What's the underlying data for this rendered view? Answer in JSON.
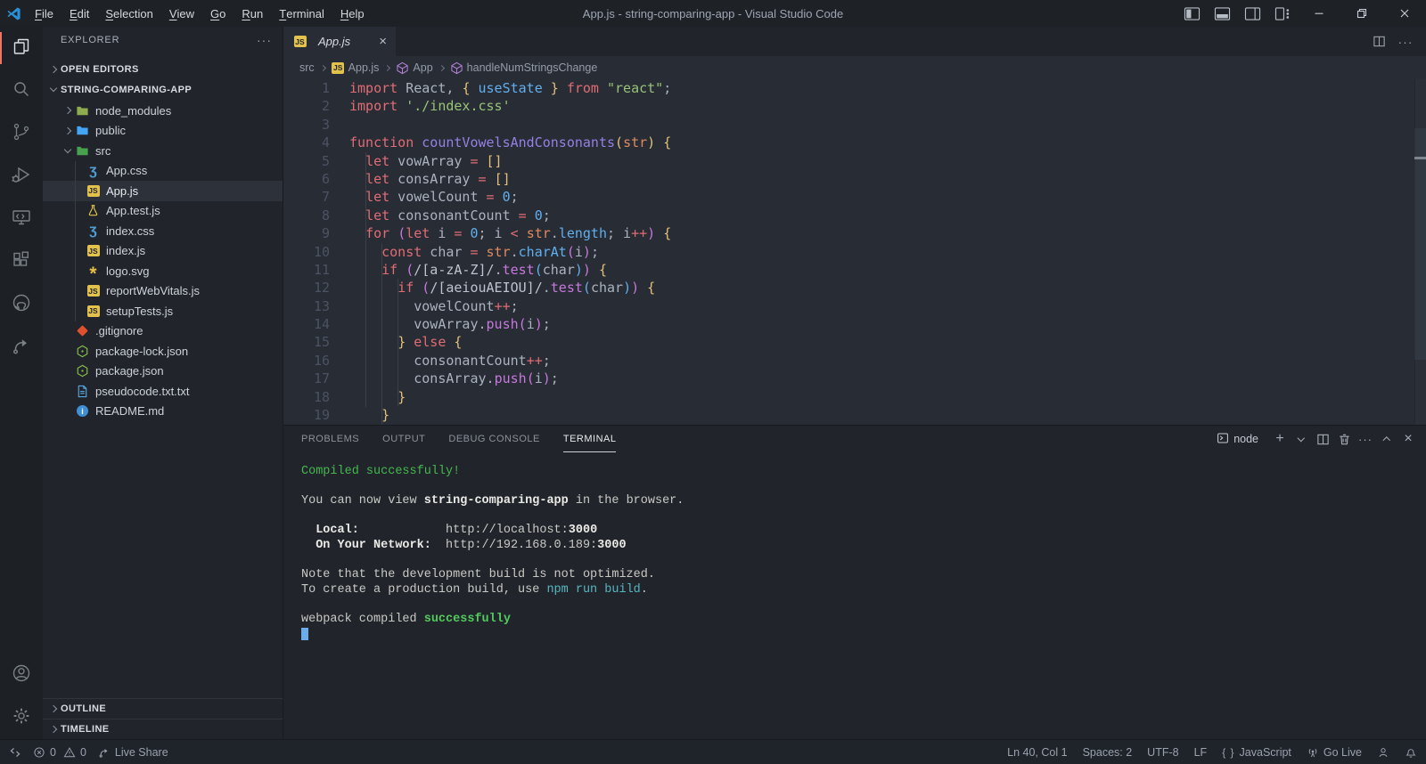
{
  "window": {
    "title": "App.js - string-comparing-app - Visual Studio Code"
  },
  "menus": [
    "File",
    "Edit",
    "Selection",
    "View",
    "Go",
    "Run",
    "Terminal",
    "Help"
  ],
  "titlebar_actions": [
    {
      "name": "toggle-sidebar",
      "icon": "panel-left"
    },
    {
      "name": "toggle-panel",
      "icon": "panel-bottom"
    },
    {
      "name": "toggle-secondary-sidebar",
      "icon": "panel-right"
    },
    {
      "name": "customize-layout",
      "icon": "layout"
    }
  ],
  "window_controls": [
    {
      "name": "minimize",
      "icon": "minimize"
    },
    {
      "name": "restore",
      "icon": "restore"
    },
    {
      "name": "close-window",
      "icon": "close-win"
    }
  ],
  "activity_bar": {
    "top": [
      {
        "name": "explorer",
        "icon": "files",
        "active": true
      },
      {
        "name": "search",
        "icon": "search"
      },
      {
        "name": "source-control",
        "icon": "source-control"
      },
      {
        "name": "run-and-debug",
        "icon": "debug"
      },
      {
        "name": "remote-explorer",
        "icon": "remote"
      },
      {
        "name": "extensions",
        "icon": "extensions"
      },
      {
        "name": "github",
        "icon": "github"
      },
      {
        "name": "live-share",
        "icon": "share"
      }
    ],
    "bottom": [
      {
        "name": "accounts",
        "icon": "account"
      },
      {
        "name": "settings",
        "icon": "gear"
      }
    ]
  },
  "sidebar": {
    "title": "EXPLORER",
    "more_glyph": "···",
    "sections": {
      "open_editors": "OPEN EDITORS",
      "project": "STRING-COMPARING-APP",
      "outline": "OUTLINE",
      "timeline": "TIMELINE"
    },
    "tree": [
      {
        "label": "node_modules",
        "icon": "folder-green",
        "depth": 1,
        "chevron": "right"
      },
      {
        "label": "public",
        "icon": "folder-blue",
        "depth": 1,
        "chevron": "right"
      },
      {
        "label": "src",
        "icon": "folder-src",
        "depth": 1,
        "chevron": "down"
      },
      {
        "label": "App.css",
        "icon": "css",
        "depth": 2
      },
      {
        "label": "App.js",
        "icon": "js",
        "depth": 2,
        "selected": true
      },
      {
        "label": "App.test.js",
        "icon": "test",
        "depth": 2
      },
      {
        "label": "index.css",
        "icon": "css",
        "depth": 2
      },
      {
        "label": "index.js",
        "icon": "js",
        "depth": 2
      },
      {
        "label": "logo.svg",
        "icon": "svg",
        "depth": 2
      },
      {
        "label": "reportWebVitals.js",
        "icon": "js",
        "depth": 2
      },
      {
        "label": "setupTests.js",
        "icon": "js",
        "depth": 2
      },
      {
        "label": ".gitignore",
        "icon": "git",
        "depth": 1
      },
      {
        "label": "package-lock.json",
        "icon": "npm",
        "depth": 1
      },
      {
        "label": "package.json",
        "icon": "npm",
        "depth": 1
      },
      {
        "label": "pseudocode.txt.txt",
        "icon": "txt",
        "depth": 1
      },
      {
        "label": "README.md",
        "icon": "info",
        "depth": 1
      }
    ]
  },
  "editor": {
    "tab": {
      "label": "App.js",
      "icon": "js",
      "close_glyph": "×"
    },
    "tab_actions": [
      {
        "name": "split-editor",
        "icon": "split"
      },
      {
        "name": "more-actions",
        "icon": "more"
      }
    ],
    "breadcrumbs": [
      {
        "label": "src"
      },
      {
        "label": "App.js",
        "icon": "js"
      },
      {
        "label": "App",
        "icon": "symbol-class"
      },
      {
        "label": "handleNumStringsChange",
        "icon": "symbol-class"
      }
    ],
    "code": [
      {
        "n": 1,
        "t": [
          [
            "kw",
            "import"
          ],
          [
            "tx",
            " React, "
          ],
          [
            "b1",
            "{"
          ],
          [
            "bl",
            " useState "
          ],
          [
            "b1",
            "}"
          ],
          [
            "kw",
            " from "
          ],
          [
            "st",
            "\"react\""
          ],
          [
            "tx",
            ";"
          ]
        ]
      },
      {
        "n": 2,
        "t": [
          [
            "kw",
            "import"
          ],
          [
            "st",
            " './index.css'"
          ]
        ]
      },
      {
        "n": 3,
        "t": []
      },
      {
        "n": 4,
        "t": [
          [
            "kw",
            "function"
          ],
          [
            "fn",
            " countVowelsAndConsonants"
          ],
          [
            "b1",
            "("
          ],
          [
            "pr",
            "str"
          ],
          [
            "b1",
            ")"
          ],
          [
            "tx",
            " "
          ],
          [
            "b1",
            "{"
          ]
        ]
      },
      {
        "n": 5,
        "t": [
          [
            "tx",
            "  "
          ],
          [
            "kw",
            "let"
          ],
          [
            "tx",
            " vowArray "
          ],
          [
            "op",
            "="
          ],
          [
            "tx",
            " "
          ],
          [
            "b1",
            "[]"
          ]
        ]
      },
      {
        "n": 6,
        "t": [
          [
            "tx",
            "  "
          ],
          [
            "kw",
            "let"
          ],
          [
            "tx",
            " consArray "
          ],
          [
            "op",
            "="
          ],
          [
            "tx",
            " "
          ],
          [
            "b1",
            "[]"
          ]
        ]
      },
      {
        "n": 7,
        "t": [
          [
            "tx",
            "  "
          ],
          [
            "kw",
            "let"
          ],
          [
            "tx",
            " vowelCount "
          ],
          [
            "op",
            "="
          ],
          [
            "tx",
            " "
          ],
          [
            "bl",
            "0"
          ],
          [
            "tx",
            ";"
          ]
        ]
      },
      {
        "n": 8,
        "t": [
          [
            "tx",
            "  "
          ],
          [
            "kw",
            "let"
          ],
          [
            "tx",
            " consonantCount "
          ],
          [
            "op",
            "="
          ],
          [
            "tx",
            " "
          ],
          [
            "bl",
            "0"
          ],
          [
            "tx",
            ";"
          ]
        ]
      },
      {
        "n": 9,
        "t": [
          [
            "tx",
            "  "
          ],
          [
            "kw",
            "for"
          ],
          [
            "tx",
            " "
          ],
          [
            "b2",
            "("
          ],
          [
            "kw",
            "let"
          ],
          [
            "tx",
            " i "
          ],
          [
            "op",
            "="
          ],
          [
            "tx",
            " "
          ],
          [
            "bl",
            "0"
          ],
          [
            "tx",
            "; i "
          ],
          [
            "op",
            "<"
          ],
          [
            "tx",
            " "
          ],
          [
            "pr",
            "str"
          ],
          [
            "tx",
            "."
          ],
          [
            "bl",
            "length"
          ],
          [
            "tx",
            "; i"
          ],
          [
            "op",
            "++"
          ],
          [
            "b2",
            ")"
          ],
          [
            "tx",
            " "
          ],
          [
            "b1",
            "{"
          ]
        ]
      },
      {
        "n": 10,
        "t": [
          [
            "tx",
            "    "
          ],
          [
            "kw",
            "const"
          ],
          [
            "tx",
            " char "
          ],
          [
            "op",
            "="
          ],
          [
            "tx",
            " "
          ],
          [
            "pr",
            "str"
          ],
          [
            "tx",
            "."
          ],
          [
            "bl",
            "charAt"
          ],
          [
            "b2",
            "("
          ],
          [
            "tx",
            "i"
          ],
          [
            "b2",
            ")"
          ],
          [
            "tx",
            ";"
          ]
        ]
      },
      {
        "n": 11,
        "t": [
          [
            "tx",
            "    "
          ],
          [
            "kw",
            "if"
          ],
          [
            "tx",
            " "
          ],
          [
            "b2",
            "("
          ],
          [
            "rx",
            "/[a-zA-Z]/"
          ],
          [
            "tx",
            "."
          ],
          [
            "mt",
            "test"
          ],
          [
            "b3",
            "("
          ],
          [
            "tx",
            "char"
          ],
          [
            "b3",
            ")"
          ],
          [
            "b2",
            ")"
          ],
          [
            "tx",
            " "
          ],
          [
            "b1",
            "{"
          ]
        ]
      },
      {
        "n": 12,
        "t": [
          [
            "tx",
            "      "
          ],
          [
            "kw",
            "if"
          ],
          [
            "tx",
            " "
          ],
          [
            "b2",
            "("
          ],
          [
            "rx",
            "/[aeiouAEIOU]/"
          ],
          [
            "tx",
            "."
          ],
          [
            "mt",
            "test"
          ],
          [
            "b3",
            "("
          ],
          [
            "tx",
            "char"
          ],
          [
            "b3",
            ")"
          ],
          [
            "b2",
            ")"
          ],
          [
            "tx",
            " "
          ],
          [
            "b1",
            "{"
          ]
        ]
      },
      {
        "n": 13,
        "t": [
          [
            "tx",
            "        vowelCount"
          ],
          [
            "op",
            "++"
          ],
          [
            "tx",
            ";"
          ]
        ]
      },
      {
        "n": 14,
        "t": [
          [
            "tx",
            "        vowArray"
          ],
          [
            "tx",
            "."
          ],
          [
            "mt",
            "push"
          ],
          [
            "b2",
            "("
          ],
          [
            "tx",
            "i"
          ],
          [
            "b2",
            ")"
          ],
          [
            "tx",
            ";"
          ]
        ]
      },
      {
        "n": 15,
        "t": [
          [
            "tx",
            "      "
          ],
          [
            "b1",
            "}"
          ],
          [
            "kw",
            " else "
          ],
          [
            "b1",
            "{"
          ]
        ]
      },
      {
        "n": 16,
        "t": [
          [
            "tx",
            "        consonantCount"
          ],
          [
            "op",
            "++"
          ],
          [
            "tx",
            ";"
          ]
        ]
      },
      {
        "n": 17,
        "t": [
          [
            "tx",
            "        consArray"
          ],
          [
            "tx",
            "."
          ],
          [
            "mt",
            "push"
          ],
          [
            "b2",
            "("
          ],
          [
            "tx",
            "i"
          ],
          [
            "b2",
            ")"
          ],
          [
            "tx",
            ";"
          ]
        ]
      },
      {
        "n": 18,
        "t": [
          [
            "tx",
            "      "
          ],
          [
            "b1",
            "}"
          ]
        ]
      },
      {
        "n": 19,
        "t": [
          [
            "tx",
            "    "
          ],
          [
            "b1",
            "}"
          ]
        ]
      }
    ]
  },
  "panel": {
    "tabs": [
      {
        "label": "PROBLEMS"
      },
      {
        "label": "OUTPUT"
      },
      {
        "label": "DEBUG CONSOLE"
      },
      {
        "label": "TERMINAL",
        "active": true
      }
    ],
    "shell": {
      "icon": "terminal",
      "label": "node"
    },
    "actions": [
      {
        "name": "new-terminal",
        "icon": "plus"
      },
      {
        "name": "launch-profile",
        "icon": "chev-down"
      },
      {
        "name": "split-terminal",
        "icon": "split"
      },
      {
        "name": "kill-terminal",
        "icon": "trash"
      },
      {
        "name": "panel-more",
        "icon": "more"
      },
      {
        "name": "maximize-panel",
        "icon": "chev-up"
      },
      {
        "name": "close-panel",
        "icon": "x"
      }
    ],
    "terminal": [
      {
        "t": [
          [
            "g",
            "Compiled successfully!"
          ]
        ]
      },
      {
        "t": []
      },
      {
        "t": [
          [
            "n",
            "You can now view "
          ],
          [
            "nb",
            "string-comparing-app"
          ],
          [
            "n",
            " in the browser."
          ]
        ]
      },
      {
        "t": []
      },
      {
        "t": [
          [
            "nb",
            "  Local:"
          ],
          [
            "n",
            "            http://localhost:"
          ],
          [
            "nb",
            "3000"
          ]
        ]
      },
      {
        "t": [
          [
            "nb",
            "  On Your Network:"
          ],
          [
            "n",
            "  http://192.168.0.189:"
          ],
          [
            "nb",
            "3000"
          ]
        ]
      },
      {
        "t": []
      },
      {
        "t": [
          [
            "n",
            "Note that the development build is not optimized."
          ]
        ]
      },
      {
        "t": [
          [
            "n",
            "To create a production build, use "
          ],
          [
            "c",
            "npm run build"
          ],
          [
            "n",
            "."
          ]
        ]
      },
      {
        "t": []
      },
      {
        "t": [
          [
            "n",
            "webpack compiled "
          ],
          [
            "gb",
            "successfully"
          ]
        ]
      },
      {
        "t": [
          [
            "cur",
            ""
          ]
        ]
      }
    ]
  },
  "status_bar": {
    "left": [
      {
        "name": "remote-indicator",
        "icon": "remote-ind"
      },
      {
        "name": "problems-errors",
        "icon": "error",
        "label": "0",
        "tight": true
      },
      {
        "name": "problems-warnings",
        "icon": "warning",
        "label": "0"
      },
      {
        "name": "live-share",
        "icon": "share-sm",
        "label": "Live Share"
      }
    ],
    "right": [
      {
        "name": "cursor-position",
        "label": "Ln 40, Col 1"
      },
      {
        "name": "indentation",
        "label": "Spaces: 2"
      },
      {
        "name": "encoding",
        "label": "UTF-8"
      },
      {
        "name": "eol",
        "label": "LF"
      },
      {
        "name": "language-mode",
        "icon": "braces",
        "label": "JavaScript"
      },
      {
        "name": "go-live",
        "icon": "broadcast",
        "label": "Go Live"
      },
      {
        "name": "feedback",
        "icon": "person"
      },
      {
        "name": "notifications",
        "icon": "bell"
      }
    ]
  }
}
